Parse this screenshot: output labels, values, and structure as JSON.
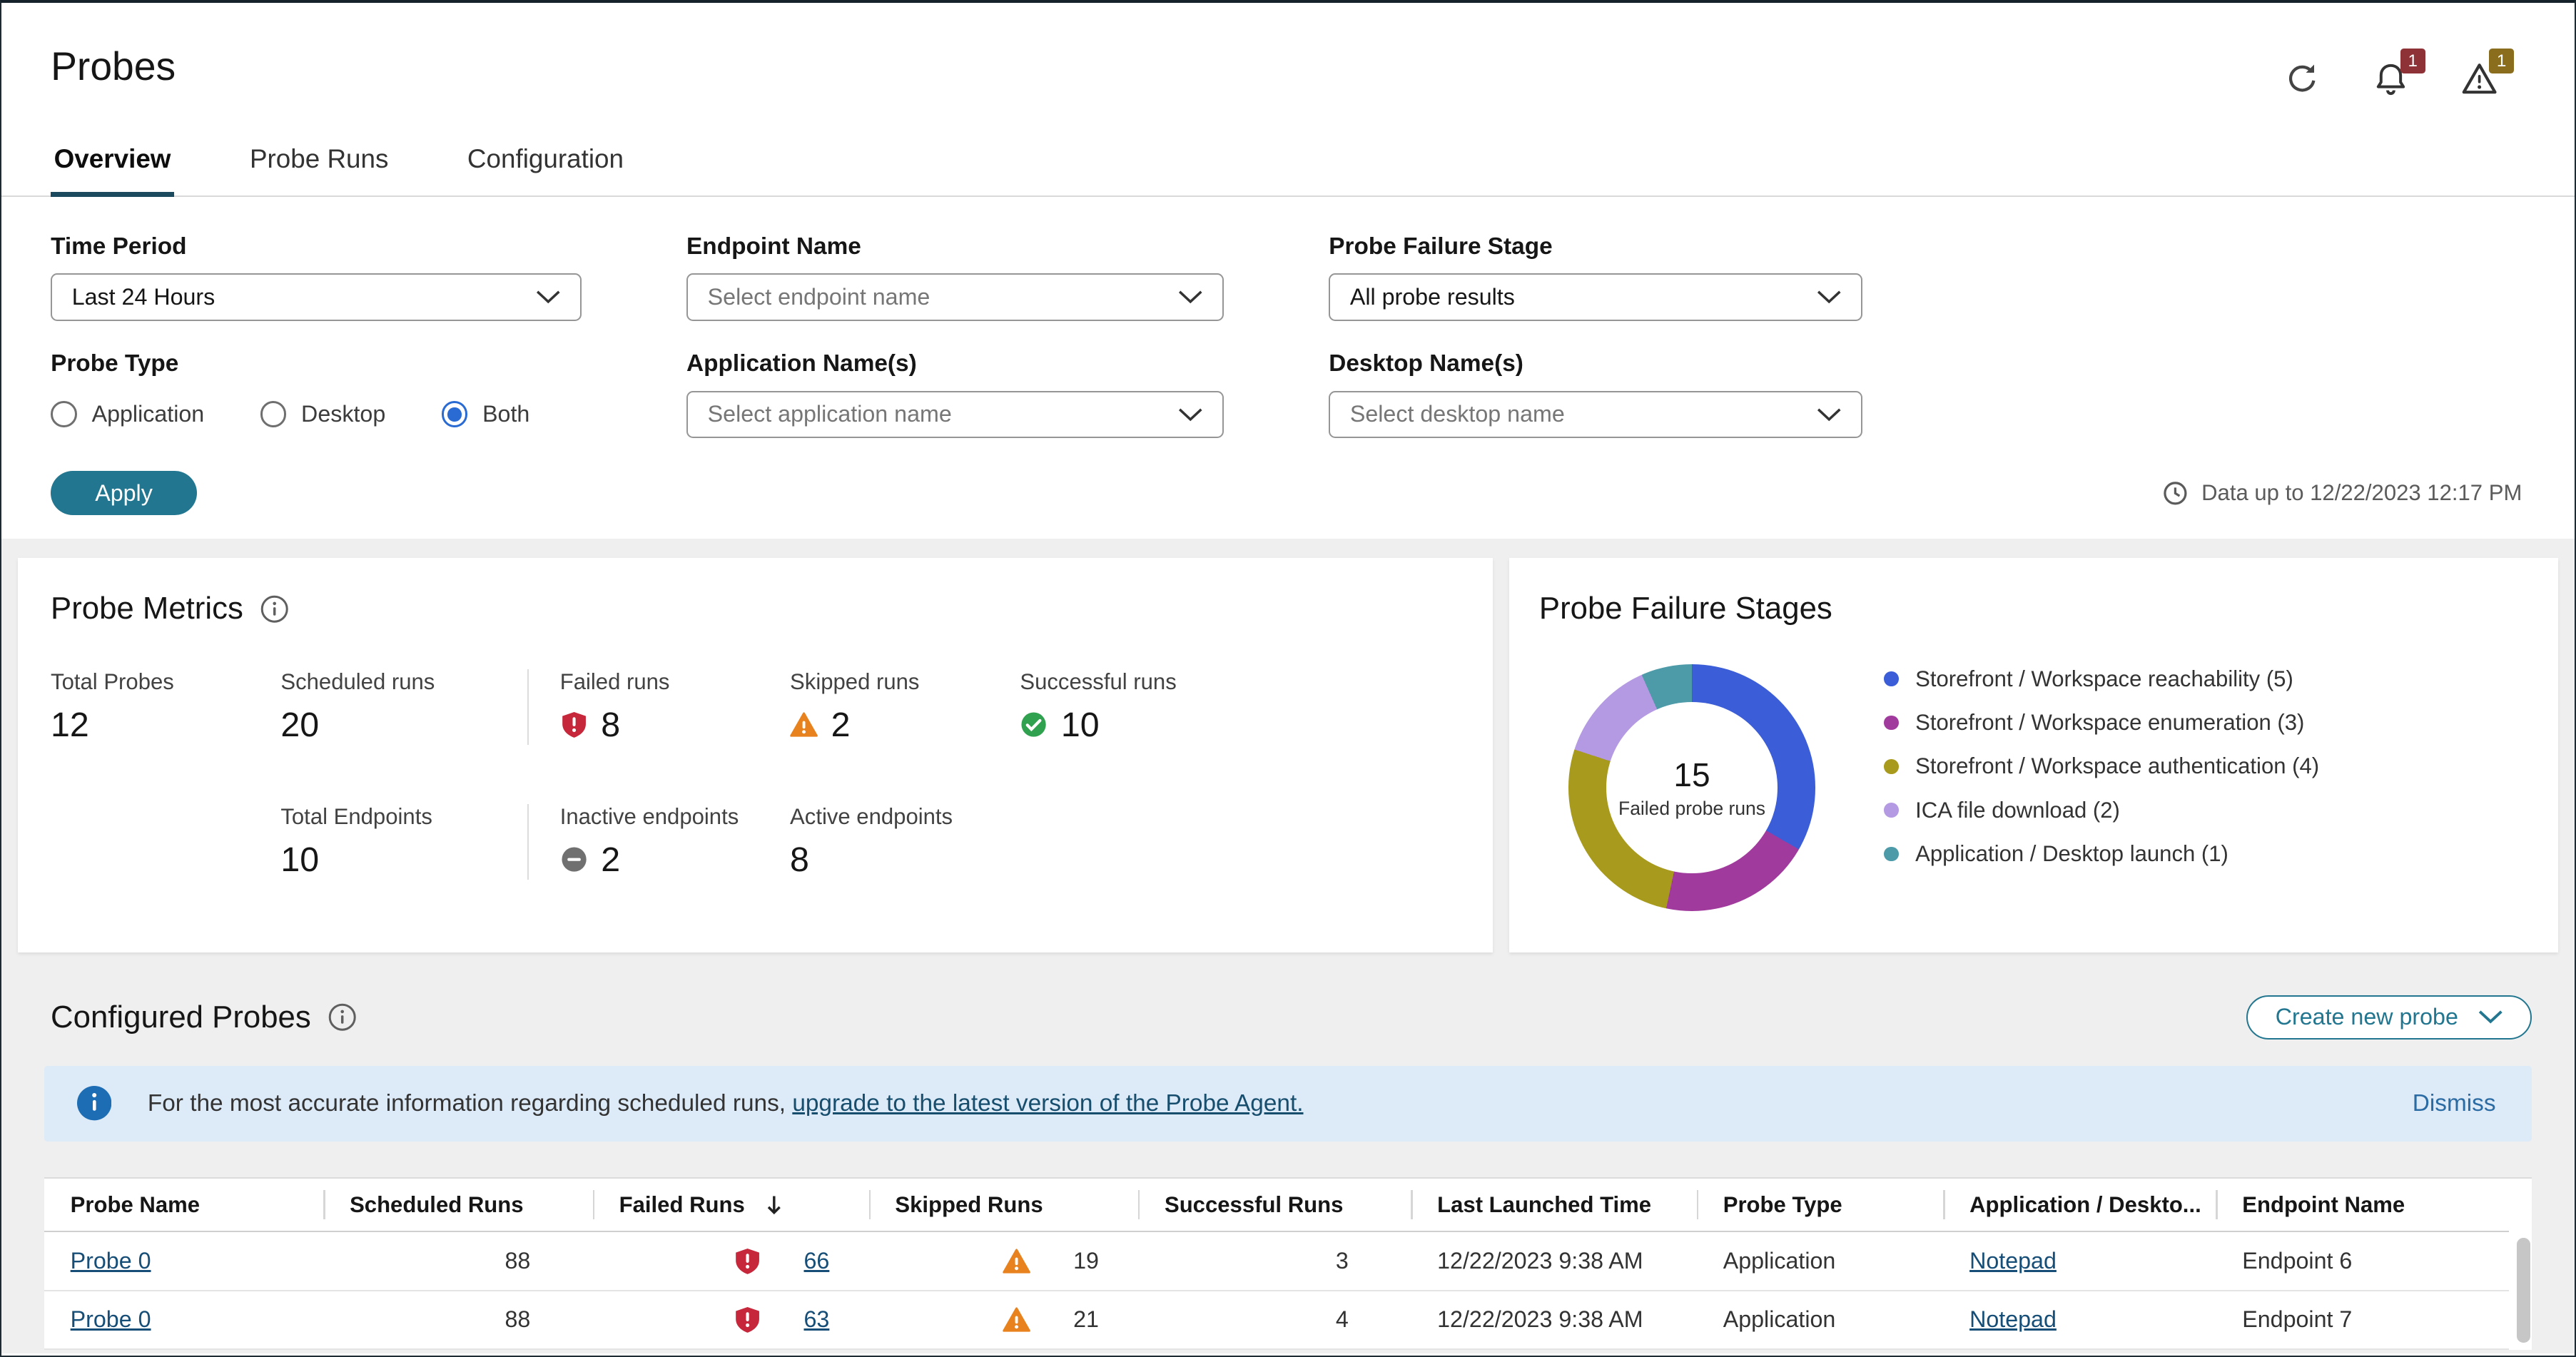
{
  "theme": {
    "accent": "#22768f",
    "link": "#164e77",
    "link_dark": "#174e6d",
    "banner_bg": "#ddeaf8",
    "banner_info": "#1d6db5",
    "critical": "#c7273a",
    "warning": "#e8821e",
    "success": "#30a14e",
    "inactive": "#707070",
    "radio_selected": "#2a6bd3",
    "alert_badge": "#8f3237",
    "warning_badge": "#8a6d1d",
    "tab_underline": "#1b4a5e"
  },
  "header": {
    "title": "Probes",
    "actions": {
      "alerts_badge": "1",
      "warnings_badge": "1"
    }
  },
  "tabs": [
    {
      "label": "Overview",
      "active": true
    },
    {
      "label": "Probe Runs",
      "active": false
    },
    {
      "label": "Configuration",
      "active": false
    }
  ],
  "filters": {
    "time_period": {
      "label": "Time Period",
      "value": "Last 24 Hours"
    },
    "endpoint_name": {
      "label": "Endpoint Name",
      "placeholder": "Select endpoint name"
    },
    "probe_failure_stage": {
      "label": "Probe Failure Stage",
      "value": "All probe results"
    },
    "probe_type": {
      "label": "Probe Type",
      "options": [
        {
          "label": "Application",
          "selected": false
        },
        {
          "label": "Desktop",
          "selected": false
        },
        {
          "label": "Both",
          "selected": true
        }
      ]
    },
    "application_names": {
      "label": "Application Name(s)",
      "placeholder": "Select application name"
    },
    "desktop_names": {
      "label": "Desktop Name(s)",
      "placeholder": "Select desktop name"
    },
    "apply_label": "Apply",
    "data_up_to": "Data up to 12/22/2023 12:17 PM"
  },
  "probe_metrics": {
    "title": "Probe Metrics",
    "rows": [
      [
        {
          "label": "Total Probes",
          "value": "12"
        },
        {
          "label": "Scheduled runs",
          "value": "20",
          "divider_after": true
        },
        {
          "label": "Failed runs",
          "value": "8",
          "icon": "failed"
        },
        {
          "label": "Skipped runs",
          "value": "2",
          "icon": "warning"
        },
        {
          "label": "Successful runs",
          "value": "10",
          "icon": "success"
        }
      ],
      [
        {
          "spacer": true
        },
        {
          "label": "Total Endpoints",
          "value": "10",
          "divider_after": true
        },
        {
          "label": "Inactive endpoints",
          "value": "2",
          "icon": "inactive"
        },
        {
          "label": "Active endpoints",
          "value": "8"
        }
      ]
    ]
  },
  "chart_data": {
    "type": "pie",
    "variant": "donut",
    "title": "Probe Failure Stages",
    "center_value": "15",
    "center_label": "Failed probe runs",
    "legend_position": "right",
    "total": 15,
    "segments": [
      {
        "label": "Storefront / Workspace reachability (5)",
        "value": 5,
        "color": "#3b5dd8"
      },
      {
        "label": "Storefront / Workspace enumeration (3)",
        "value": 3,
        "color": "#a03a9c"
      },
      {
        "label": "Storefront / Workspace authentication (4)",
        "value": 4,
        "color": "#a89a1d"
      },
      {
        "label": "ICA file download (2)",
        "value": 2,
        "color": "#b49ae2"
      },
      {
        "label": "Application / Desktop launch (1)",
        "value": 1,
        "color": "#4d9aa8"
      }
    ]
  },
  "configured_probes": {
    "title": "Configured Probes",
    "create_button_label": "Create new probe",
    "banner": {
      "text": "For the most accurate information regarding scheduled runs, ",
      "link_text": "upgrade to the latest version of the Probe Agent.",
      "dismiss_label": "Dismiss"
    },
    "columns": [
      {
        "label": "Probe Name",
        "key": "probe_name"
      },
      {
        "label": "Scheduled Runs",
        "key": "scheduled_runs"
      },
      {
        "label": "Failed Runs",
        "key": "failed_runs",
        "sort": "desc"
      },
      {
        "label": "Skipped Runs",
        "key": "skipped_runs"
      },
      {
        "label": "Successful Runs",
        "key": "successful_runs"
      },
      {
        "label": "Last Launched Time",
        "key": "last_launched_time"
      },
      {
        "label": "Probe Type",
        "key": "probe_type"
      },
      {
        "label": "Application / Deskto...",
        "key": "application_desktop"
      },
      {
        "label": "Endpoint Name",
        "key": "endpoint_name"
      }
    ],
    "rows": [
      {
        "probe_name": "Probe 0",
        "scheduled_runs": "88",
        "failed_runs": "66",
        "skipped_runs": "19",
        "successful_runs": "3",
        "last_launched_time": "12/22/2023 9:38 AM",
        "probe_type": "Application",
        "application_desktop": "Notepad",
        "endpoint_name": "Endpoint 6"
      },
      {
        "probe_name": "Probe 0",
        "scheduled_runs": "88",
        "failed_runs": "63",
        "skipped_runs": "21",
        "successful_runs": "4",
        "last_launched_time": "12/22/2023 9:38 AM",
        "probe_type": "Application",
        "application_desktop": "Notepad",
        "endpoint_name": "Endpoint 7"
      }
    ]
  }
}
